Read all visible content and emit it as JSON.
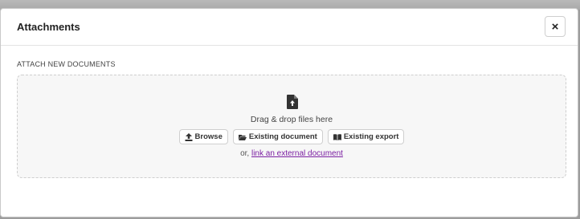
{
  "dialog": {
    "title": "Attachments",
    "close_label": "×"
  },
  "section": {
    "label": "ATTACH NEW DOCUMENTS"
  },
  "dropzone": {
    "icon": "file-upload-icon",
    "instruction": "Drag & drop files here",
    "buttons": [
      {
        "label": "Browse",
        "icon": "upload-icon"
      },
      {
        "label": "Existing document",
        "icon": "folder-open-icon"
      },
      {
        "label": "Existing export",
        "icon": "book-icon"
      }
    ],
    "link_prefix": "or,",
    "link_text": "link an external document"
  },
  "colors": {
    "link": "#7b1fa2",
    "dropzone_bg": "#f7f7f7"
  }
}
